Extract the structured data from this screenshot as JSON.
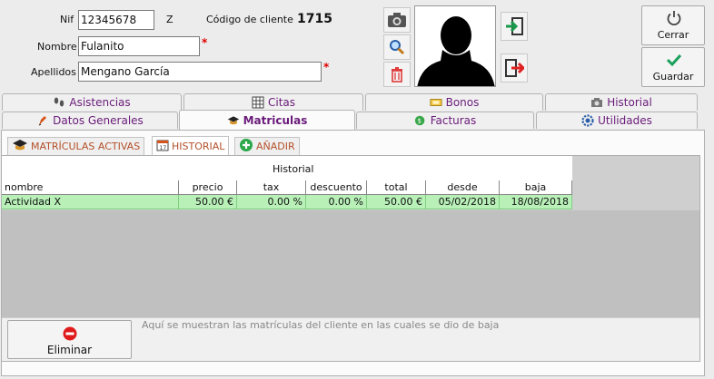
{
  "client": {
    "nif_label": "Nif",
    "nif_value": "12345678",
    "nif_letter": "Z",
    "code_label": "Código de cliente",
    "code_value": "1715",
    "name_label": "Nombre",
    "name_value": "Fulanito",
    "surname_label": "Apellidos",
    "surname_value": "Mengano García",
    "required_mark": "*"
  },
  "actions": {
    "close_label": "Cerrar",
    "save_label": "Guardar"
  },
  "tabs_top": [
    {
      "label": "Asistencias",
      "icon": "footprints-icon"
    },
    {
      "label": "Citas",
      "icon": "calendar-grid-icon"
    },
    {
      "label": "Bonos",
      "icon": "ticket-icon"
    },
    {
      "label": "Historial",
      "icon": "camera-icon"
    }
  ],
  "tabs_bottom": [
    {
      "label": "Datos Generales",
      "icon": "pen-icon"
    },
    {
      "label": "Matriculas",
      "icon": "graduation-cap-icon",
      "active": true
    },
    {
      "label": "Facturas",
      "icon": "invoice-icon"
    },
    {
      "label": "Utilidades",
      "icon": "gear-icon"
    }
  ],
  "subtabs": [
    {
      "label": "MATRÍCULAS ACTIVAS",
      "icon": "graduation-cap-icon"
    },
    {
      "label": "HISTORIAL",
      "icon": "calendar-icon",
      "active": true
    },
    {
      "label": "AÑADIR",
      "icon": "plus-circle-icon"
    }
  ],
  "table": {
    "title": "Historial",
    "columns": [
      "nombre",
      "precio",
      "tax",
      "descuento",
      "total",
      "desde",
      "baja"
    ],
    "rows": [
      [
        "Actividad X",
        "50.00 €",
        "0.00 %",
        "0.00 %",
        "50.00 €",
        "05/02/2018",
        "18/08/2018"
      ]
    ]
  },
  "footer": {
    "delete_label": "Eliminar",
    "info_text": "Aquí se muestran las matrículas del cliente en las cuales se dio de baja"
  },
  "colors": {
    "accent_tab": "#6a1b7a",
    "row_selected": "#b8f0b8",
    "required": "#e00000",
    "subtab_text": "#b3502a"
  }
}
